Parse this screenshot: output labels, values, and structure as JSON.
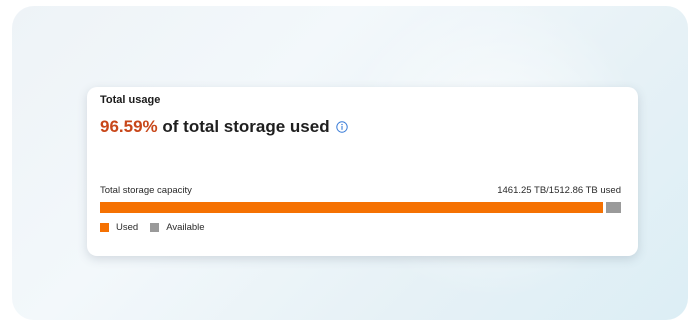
{
  "card": {
    "title": "Total usage",
    "percent": "96.59%",
    "headline_rest": " of total storage used",
    "info_icon": "info-circle-icon"
  },
  "capacity": {
    "label": "Total storage capacity",
    "value_text": "1461.25 TB/1512.86 TB used",
    "used_tb": 1461.25,
    "total_tb": 1512.86,
    "used_fraction": 0.9659
  },
  "legend": {
    "used_label": "Used",
    "available_label": "Available"
  },
  "colors": {
    "used": "#f57102",
    "available": "#9a9a9a",
    "percent_text": "#c8471a",
    "info_icon": "#3b7dd8"
  }
}
